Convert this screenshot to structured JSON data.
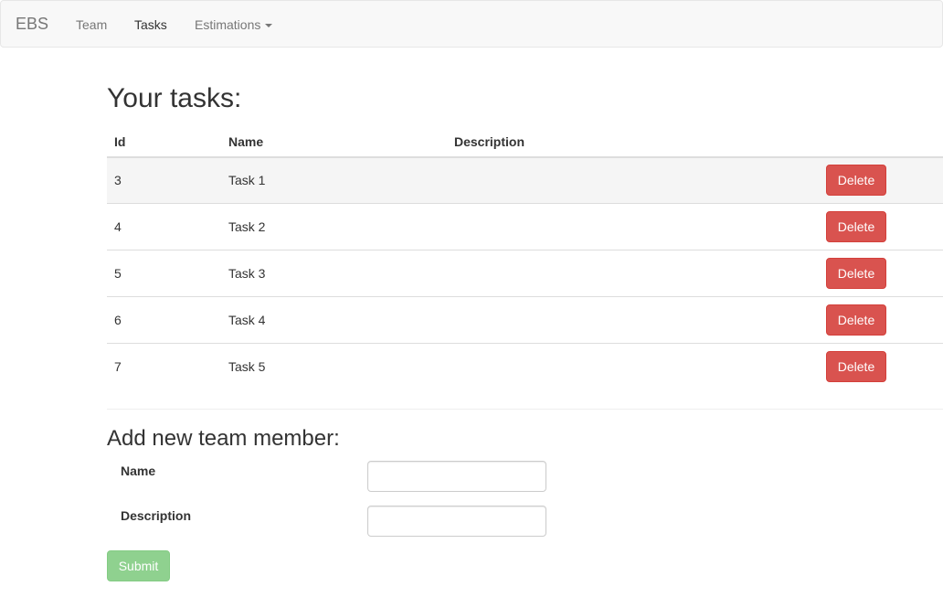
{
  "navbar": {
    "brand": "EBS",
    "links": [
      {
        "label": "Team",
        "active": false
      },
      {
        "label": "Tasks",
        "active": true
      },
      {
        "label": "Estimations",
        "active": false,
        "dropdown": true
      }
    ]
  },
  "tasks": {
    "title": "Your tasks:",
    "columns": [
      "Id",
      "Name",
      "Description"
    ],
    "rows": [
      {
        "id": "3",
        "name": "Task 1",
        "description": "",
        "action": "Delete"
      },
      {
        "id": "4",
        "name": "Task 2",
        "description": "",
        "action": "Delete"
      },
      {
        "id": "5",
        "name": "Task 3",
        "description": "",
        "action": "Delete"
      },
      {
        "id": "6",
        "name": "Task 4",
        "description": "",
        "action": "Delete"
      },
      {
        "id": "7",
        "name": "Task 5",
        "description": "",
        "action": "Delete"
      }
    ]
  },
  "form": {
    "title": "Add new team member:",
    "fields": [
      {
        "label": "Name",
        "value": ""
      },
      {
        "label": "Description",
        "value": ""
      }
    ],
    "submit_label": "Submit"
  },
  "colors": {
    "danger": "#d9534f",
    "submit_disabled": "#8fd18f",
    "navbar_bg": "#f8f8f8"
  }
}
